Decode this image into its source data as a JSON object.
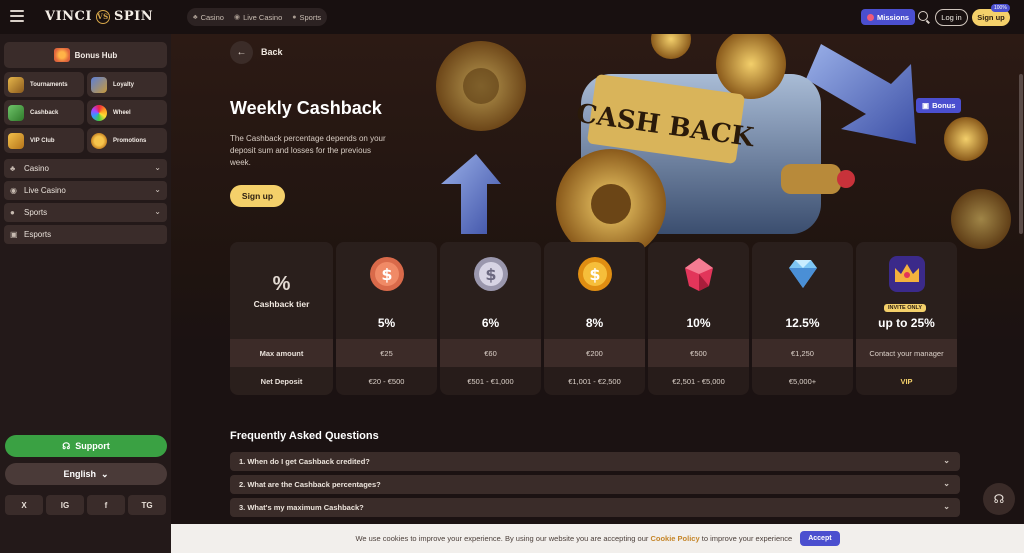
{
  "header": {
    "logo": "VINCI",
    "logo2": "SPIN",
    "nav": [
      {
        "label": "Casino"
      },
      {
        "label": "Live Casino"
      },
      {
        "label": "Sports"
      }
    ],
    "missions": "Missions",
    "login": "Log in",
    "signup": "Sign up",
    "signup_badge": "100%"
  },
  "sidebar": {
    "bonus_hub": "Bonus Hub",
    "tiles": [
      {
        "label": "Tournaments"
      },
      {
        "label": "Loyalty"
      },
      {
        "label": "Cashback"
      },
      {
        "label": "Wheel"
      },
      {
        "label": "VIP Club"
      },
      {
        "label": "Promotions"
      }
    ],
    "menu": [
      {
        "label": "Casino"
      },
      {
        "label": "Live Casino"
      },
      {
        "label": "Sports"
      },
      {
        "label": "Esports"
      }
    ],
    "support": "Support",
    "language": "English",
    "socials": [
      "X",
      "IG",
      "f",
      "TG"
    ]
  },
  "page": {
    "back": "Back",
    "title": "Weekly Cashback",
    "description": "The Cashback percentage depends on your deposit sum and losses for the previous week.",
    "signup": "Sign up",
    "hero_sign": "CASH BACK",
    "bonus_pill": "Bonus"
  },
  "tiers": {
    "header_symbol": "%",
    "header_label": "Cashback tier",
    "max_label": "Max amount",
    "deposit_label": "Net Deposit",
    "invite": "INVITE ONLY",
    "items": [
      {
        "percent": "5%",
        "max": "€25",
        "deposit": "€20 - €500",
        "icon": "bronze-coin-icon",
        "color": "#d96a4a"
      },
      {
        "percent": "6%",
        "max": "€60",
        "deposit": "€501 - €1,000",
        "icon": "silver-coin-icon",
        "color": "#b9b6c8"
      },
      {
        "percent": "8%",
        "max": "€200",
        "deposit": "€1,001 - €2,500",
        "icon": "gold-coin-icon",
        "color": "#f2a524"
      },
      {
        "percent": "10%",
        "max": "€500",
        "deposit": "€2,501 - €5,000",
        "icon": "ruby-icon",
        "color": "#e2355a"
      },
      {
        "percent": "12.5%",
        "max": "€1,250",
        "deposit": "€5,000+",
        "icon": "diamond-icon",
        "color": "#7ec6f4"
      },
      {
        "percent": "up to 25%",
        "max": "Contact your manager",
        "deposit": "VIP",
        "icon": "crown-icon",
        "color": "#f4b13d"
      }
    ]
  },
  "faq": {
    "title": "Frequently Asked Questions",
    "items": [
      {
        "q": "1.  When do I get Cashback credited?"
      },
      {
        "q": "2.  What are the Cashback percentages?"
      },
      {
        "q": "3.  What's my maximum Cashback?"
      }
    ]
  },
  "cookie": {
    "text": "We use cookies to improve your experience. By using our website you are accepting our",
    "link": "Cookie Policy",
    "text2": "to improve your experience",
    "accept": "Accept"
  }
}
